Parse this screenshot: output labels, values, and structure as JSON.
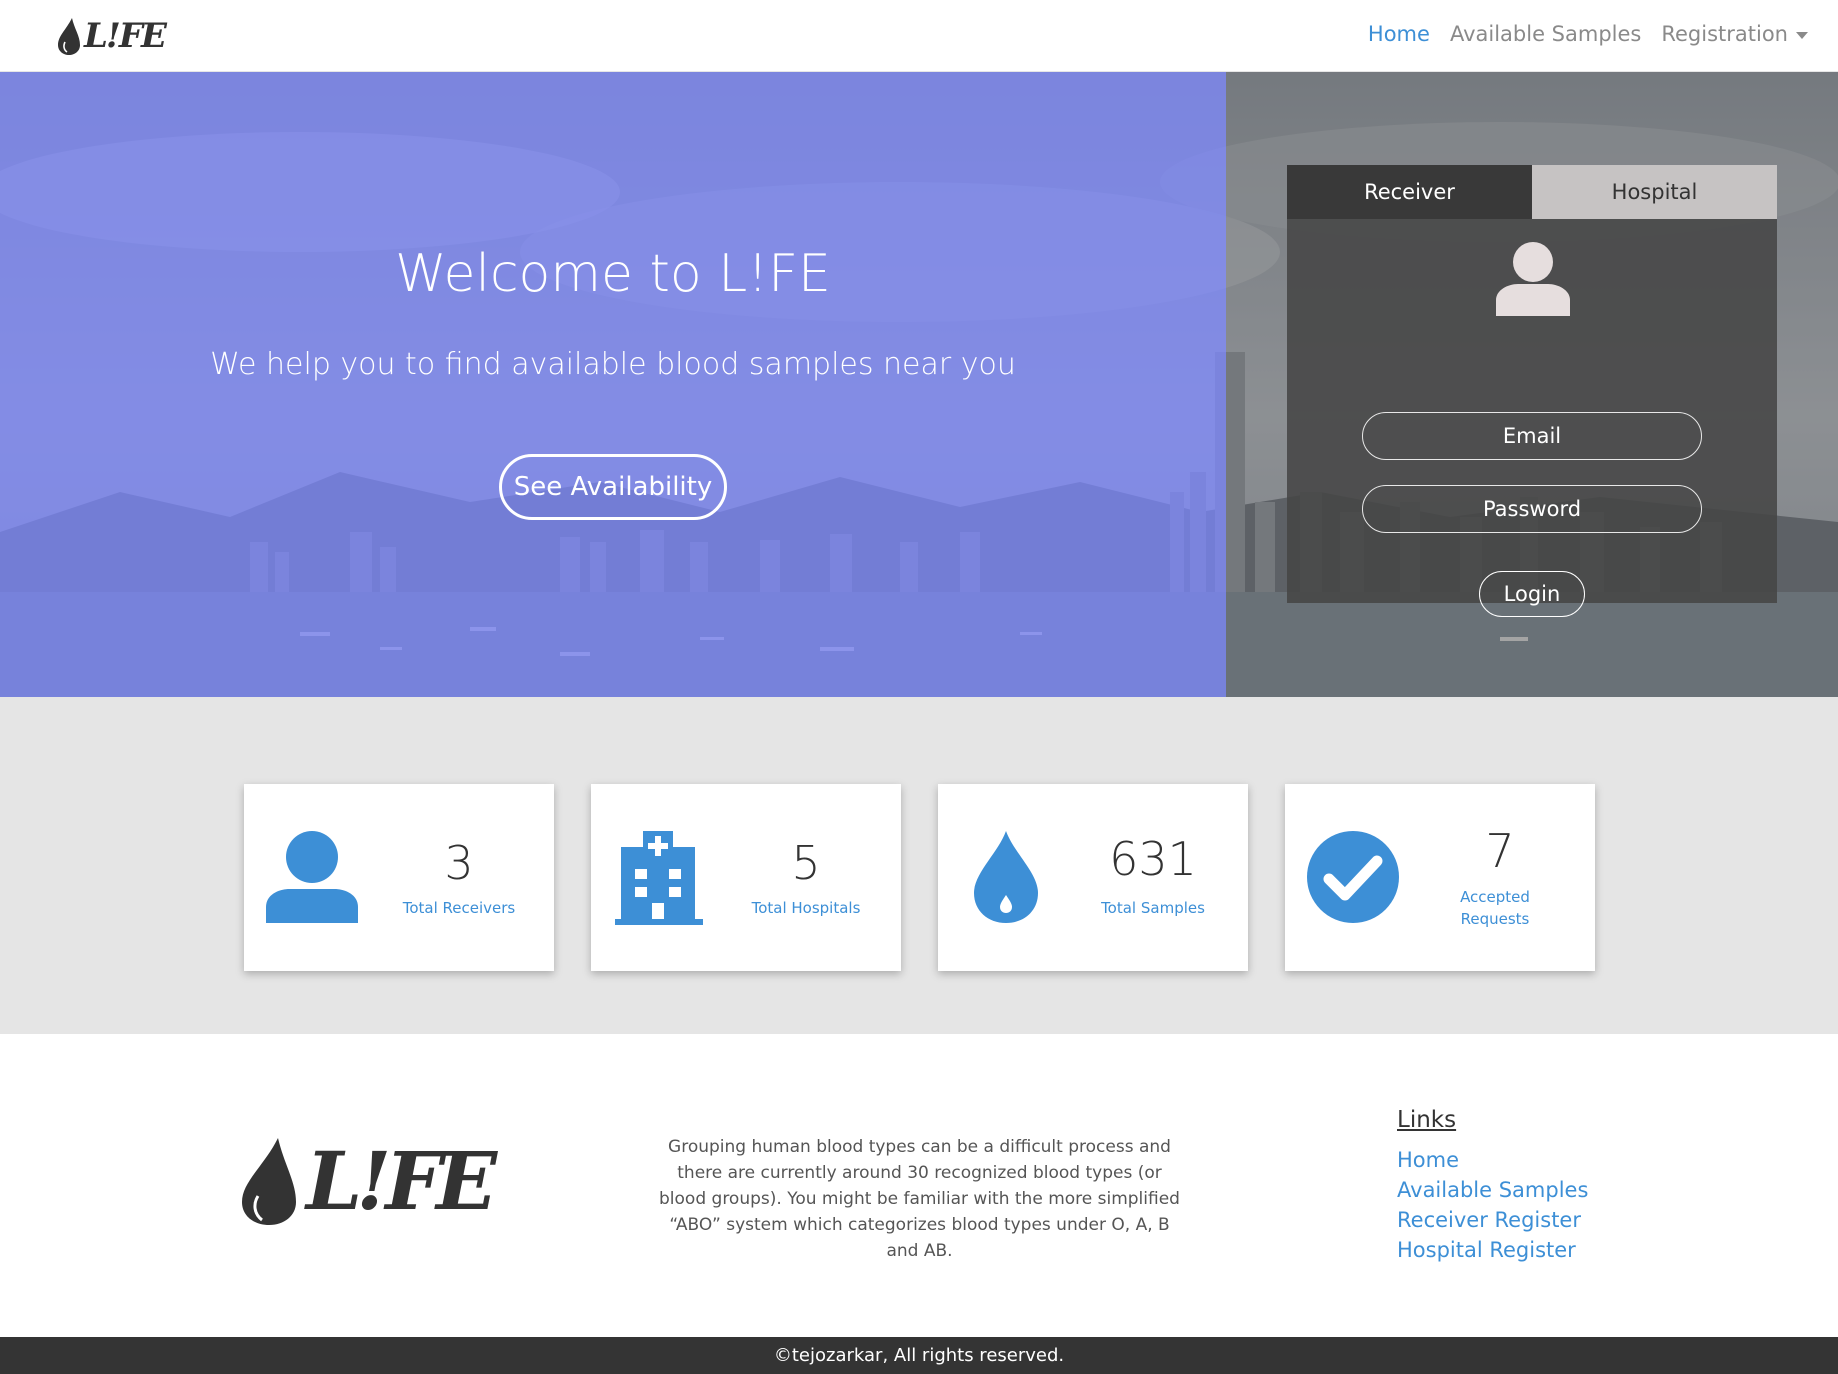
{
  "navbar": {
    "brand": "L!FE",
    "links": [
      {
        "label": "Home",
        "active": true
      },
      {
        "label": "Available Samples",
        "active": false
      },
      {
        "label": "Registration",
        "active": false,
        "dropdown": true
      }
    ]
  },
  "hero": {
    "title": "Welcome to L!FE",
    "tagline": "We help you to find available blood samples near you",
    "cta": "See Availability"
  },
  "login": {
    "tabs": [
      {
        "label": "Receiver",
        "active": true
      },
      {
        "label": "Hospital",
        "active": false
      }
    ],
    "email_placeholder": "Email",
    "password_placeholder": "Password",
    "button": "Login",
    "avatar_icon": "user-avatar-icon"
  },
  "stats": [
    {
      "icon": "user-icon",
      "value": "3",
      "label": "Total Receivers"
    },
    {
      "icon": "hospital-icon",
      "value": "5",
      "label": "Total Hospitals"
    },
    {
      "icon": "blood-drop-icon",
      "value": "631",
      "label": "Total Samples"
    },
    {
      "icon": "check-circle-icon",
      "value": "7",
      "label": "Accepted Requests"
    }
  ],
  "footer": {
    "logo": "L!FE",
    "description": "Grouping human blood types can be a difficult process and there are currently around 30 recognized blood types (or blood groups). You might be familiar with the more simplified “ABO” system which categorizes blood types under O, A, B and AB.",
    "links_title": "Links",
    "links": [
      "Home",
      "Available Samples",
      "Receiver Register",
      "Hospital Register"
    ],
    "copyright": "©tejozarkar, All rights reserved."
  },
  "colors": {
    "accent": "#3d8fd6",
    "hero_tint": "#7680f0",
    "dark": "#343434",
    "stats_bg": "#e5e5e5"
  }
}
